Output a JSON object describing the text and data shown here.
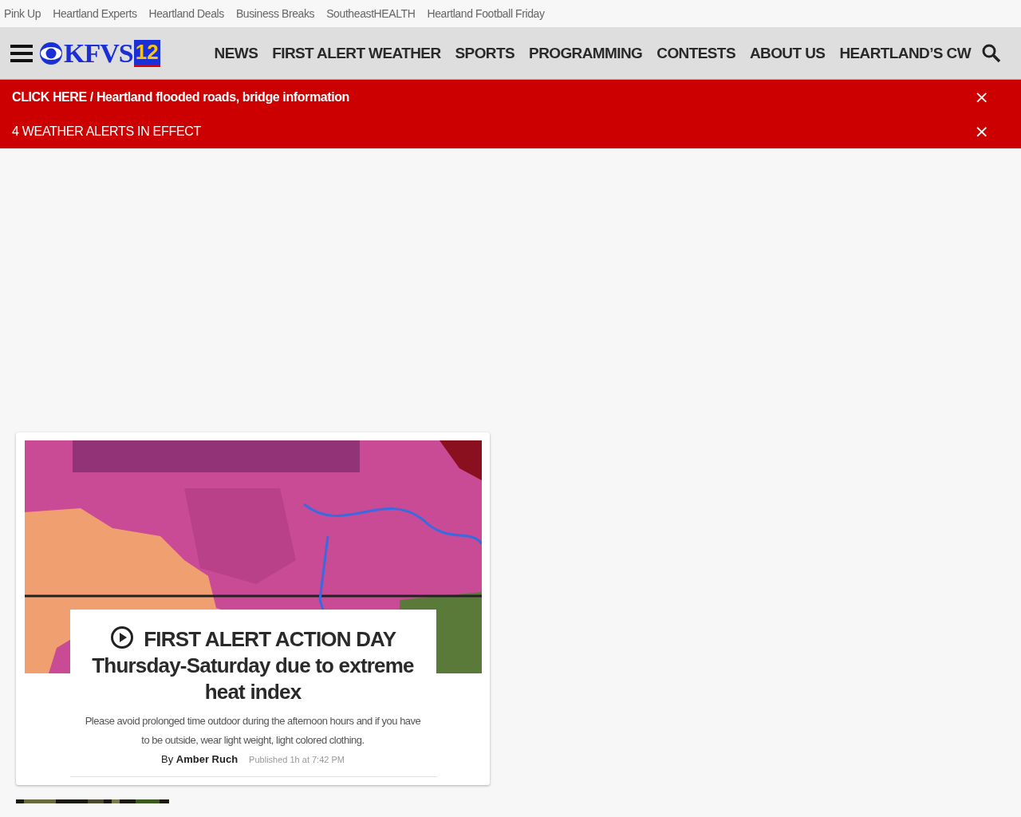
{
  "top_links": [
    "Pink Up",
    "Heartland Experts",
    "Heartland Deals",
    "Business Breaks",
    "SoutheastHEALTH",
    "Heartland Football Friday"
  ],
  "header": {
    "logo": {
      "letters": "KFVS",
      "channel": "12"
    },
    "nav": [
      "NEWS",
      "FIRST ALERT WEATHER",
      "SPORTS",
      "PROGRAMMING",
      "CONTESTS",
      "ABOUT US",
      "HEARTLAND’S CW"
    ]
  },
  "alerts": [
    {
      "kind": "link",
      "lead": "CLICK HERE",
      "separator": "/",
      "text": "Heartland flooded roads, bridge information",
      "close": "×"
    },
    {
      "kind": "plain",
      "text": "4 WEATHER ALERTS IN EFFECT",
      "close": "×"
    }
  ],
  "story": {
    "image": {
      "kind": "picture"
    },
    "headline": "FIRST ALERT ACTION DAY Thursday-Saturday due to extreme heat index",
    "summary": "Please avoid prolonged time outdoor during the afternoon hours and if you have to be outside, wear light weight, light colored clothing.",
    "byline_prefix": "By",
    "author": "Amber Ruch",
    "published": "Published 1h at 7:42 PM"
  },
  "next_story": {
    "image": {
      "kind": "picture"
    }
  }
}
